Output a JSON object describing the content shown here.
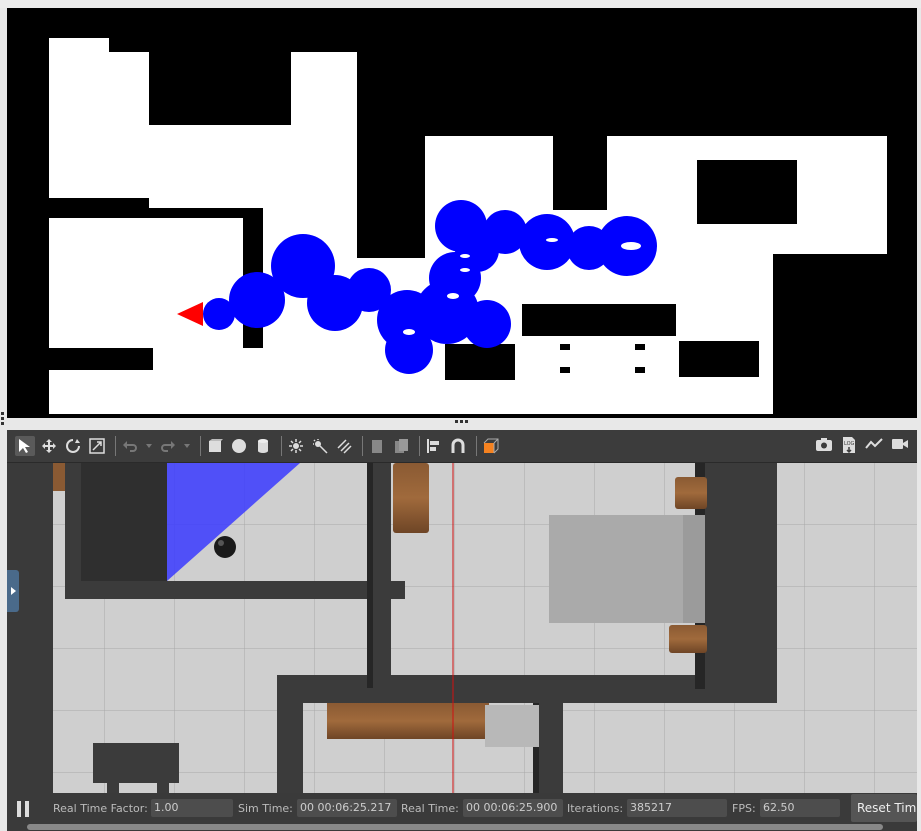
{
  "colors": {
    "occupied": "#000000",
    "free": "#ffffff",
    "path": "#0000ff",
    "robot_marker": "#ff0000"
  },
  "toolbar": {
    "left_icons": [
      "select-arrow-icon",
      "translate-icon",
      "rotate-icon",
      "scale-icon",
      "undo-icon",
      "undo-history-icon",
      "redo-icon",
      "redo-history-icon",
      "box-shape-icon",
      "sphere-shape-icon",
      "cylinder-shape-icon",
      "point-light-icon",
      "spot-light-icon",
      "directional-light-icon",
      "copy-icon",
      "paste-icon",
      "align-icon",
      "snap-icon",
      "view-angle-icon"
    ],
    "right_icons": [
      "screenshot-icon",
      "log-icon",
      "plot-icon",
      "record-video-icon"
    ]
  },
  "stats": {
    "real_time_factor_label": "Real Time Factor:",
    "real_time_factor": "1.00",
    "sim_time_label": "Sim Time:",
    "sim_time": "00 00:06:25.217",
    "real_time_label": "Real Time:",
    "real_time": "00 00:06:25.900",
    "iterations_label": "Iterations:",
    "iterations": "385217",
    "fps_label": "FPS:",
    "fps": "62.50",
    "reset_label": "Reset Time"
  }
}
